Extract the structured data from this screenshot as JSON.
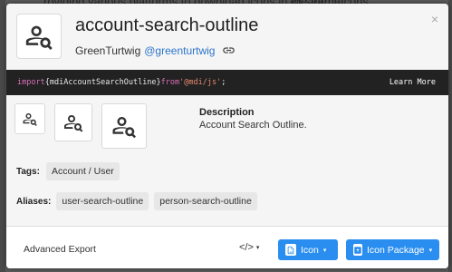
{
  "background": {
    "left_text": "roviding various platforms to download icons in the format:",
    "right_text": "@ searchIcons"
  },
  "header": {
    "title": "account-search-outline",
    "author_name": "GreenTurtwig",
    "author_handle": "@greenturtwig",
    "close_glyph": "×"
  },
  "code": {
    "kw_import": "import",
    "brace_open": " { ",
    "identifier": "mdiAccountSearchOutline",
    "brace_close": " } ",
    "kw_from": "from",
    "module": " '@mdi/js'",
    "semicolon": ";",
    "learn_more": "Learn More"
  },
  "details": {
    "description_label": "Description",
    "description_text": "Account Search Outline."
  },
  "tags": {
    "label": "Tags:",
    "items": [
      "Account / User"
    ]
  },
  "aliases": {
    "label": "Aliases:",
    "items": [
      "user-search-outline",
      "person-search-outline"
    ]
  },
  "footer": {
    "advanced_export": "Advanced Export",
    "code_glyph": "</>",
    "icon_button": "Icon",
    "package_button": "Icon Package",
    "caret": "▾"
  },
  "colors": {
    "accent": "#2a8ef0",
    "code_bg": "#222222",
    "link": "#2c75c9"
  },
  "icons": [
    "account-search-outline-icon",
    "link-icon",
    "close-icon",
    "code-icon",
    "file-image-icon",
    "package-icon",
    "caret-down-icon"
  ]
}
